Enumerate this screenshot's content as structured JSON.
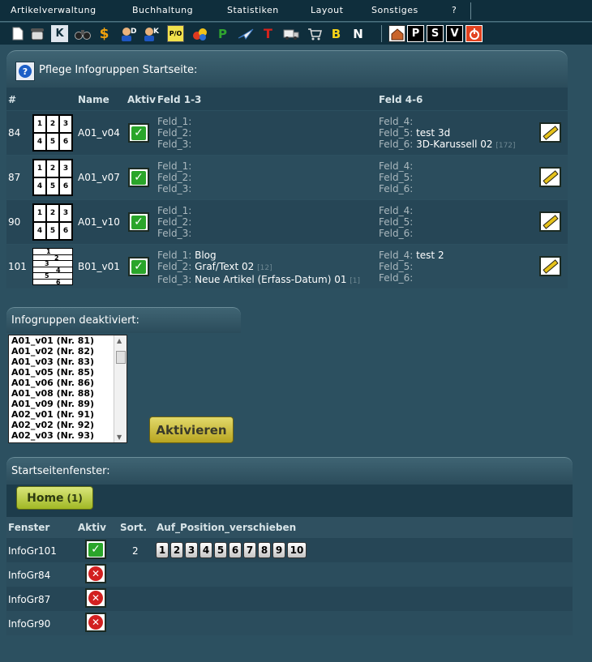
{
  "menu": {
    "items": [
      "Artikelverwaltung",
      "Buchhaltung",
      "Statistiken",
      "Layout",
      "Sonstiges",
      "?"
    ]
  },
  "toolbar": {
    "icons": [
      "new-document-icon",
      "phone-icon",
      "k-letter-icon",
      "binoculars-icon",
      "dollar-icon",
      "user-d-icon",
      "user-k-icon",
      "pio-icon",
      "palette-icon",
      "p-green-icon",
      "plane-icon",
      "t-red-icon",
      "truck-icon",
      "cart-icon",
      "b-letter-icon",
      "n-letter-icon",
      "home-icon",
      "p-box-icon",
      "s-box-icon",
      "v-box-icon",
      "power-icon"
    ],
    "letters": {
      "k": "K",
      "p_green": "P",
      "t_red": "T",
      "b": "B",
      "n": "N",
      "p_box": "P",
      "s_box": "S",
      "v_box": "V",
      "pio": "P/O",
      "dollar": "$"
    }
  },
  "infogruppen": {
    "title": "Pflege Infogruppen Startseite:",
    "headers": {
      "num": "#",
      "name": "Name",
      "aktiv": "Aktiv",
      "feld13": "Feld 1-3",
      "feld46": "Feld 4-6"
    },
    "rows": [
      {
        "num": "84",
        "name": "A01_v04",
        "f1": "",
        "f2": "",
        "f3": "",
        "f4": "",
        "f5": "test 3d",
        "f6": "3D-Karussell 02",
        "f6n": "[172]",
        "f2n": "",
        "f3n": ""
      },
      {
        "num": "87",
        "name": "A01_v07",
        "f1": "",
        "f2": "",
        "f3": "",
        "f4": "",
        "f5": "",
        "f6": "",
        "f6n": "",
        "f2n": "",
        "f3n": ""
      },
      {
        "num": "90",
        "name": "A01_v10",
        "f1": "",
        "f2": "",
        "f3": "",
        "f4": "",
        "f5": "",
        "f6": "",
        "f6n": "",
        "f2n": "",
        "f3n": ""
      },
      {
        "num": "101",
        "name": "B01_v01",
        "f1": "Blog",
        "f2": "Graf/Text 02",
        "f2n": "[12]",
        "f3": "Neue Artikel (Erfass-Datum) 01",
        "f3n": "[1]",
        "f4": "test 2",
        "f5": "",
        "f6": "",
        "f6n": ""
      }
    ],
    "labels": {
      "f1": "Feld_1:",
      "f2": "Feld_2:",
      "f3": "Feld_3:",
      "f4": "Feld_4:",
      "f5": "Feld_5:",
      "f6": "Feld_6:"
    },
    "grid_numbers": [
      "1",
      "2",
      "3",
      "4",
      "5",
      "6"
    ]
  },
  "deaktiviert": {
    "title": "Infogruppen deaktiviert:",
    "items": [
      "A01_v01 (Nr. 81)",
      "A01_v02 (Nr. 82)",
      "A01_v03 (Nr. 83)",
      "A01_v05 (Nr. 85)",
      "A01_v06 (Nr. 86)",
      "A01_v08 (Nr. 88)",
      "A01_v09 (Nr. 89)",
      "A02_v01 (Nr. 91)",
      "A02_v02 (Nr. 92)",
      "A02_v03 (Nr. 93)"
    ],
    "button": "Aktivieren"
  },
  "startseite": {
    "title": "Startseitenfenster:",
    "home_label": "Home",
    "home_count": "(1)",
    "headers": {
      "fenster": "Fenster",
      "aktiv": "Aktiv",
      "sort": "Sort.",
      "pos": "Auf_Position_verschieben"
    },
    "rows": [
      {
        "name": "InfoGr101",
        "aktiv": true,
        "sort": "2"
      },
      {
        "name": "InfoGr84",
        "aktiv": false,
        "sort": ""
      },
      {
        "name": "InfoGr87",
        "aktiv": false,
        "sort": ""
      },
      {
        "name": "InfoGr90",
        "aktiv": false,
        "sort": ""
      }
    ],
    "positions": [
      "1",
      "2",
      "3",
      "4",
      "5",
      "6",
      "7",
      "8",
      "9",
      "10"
    ]
  }
}
